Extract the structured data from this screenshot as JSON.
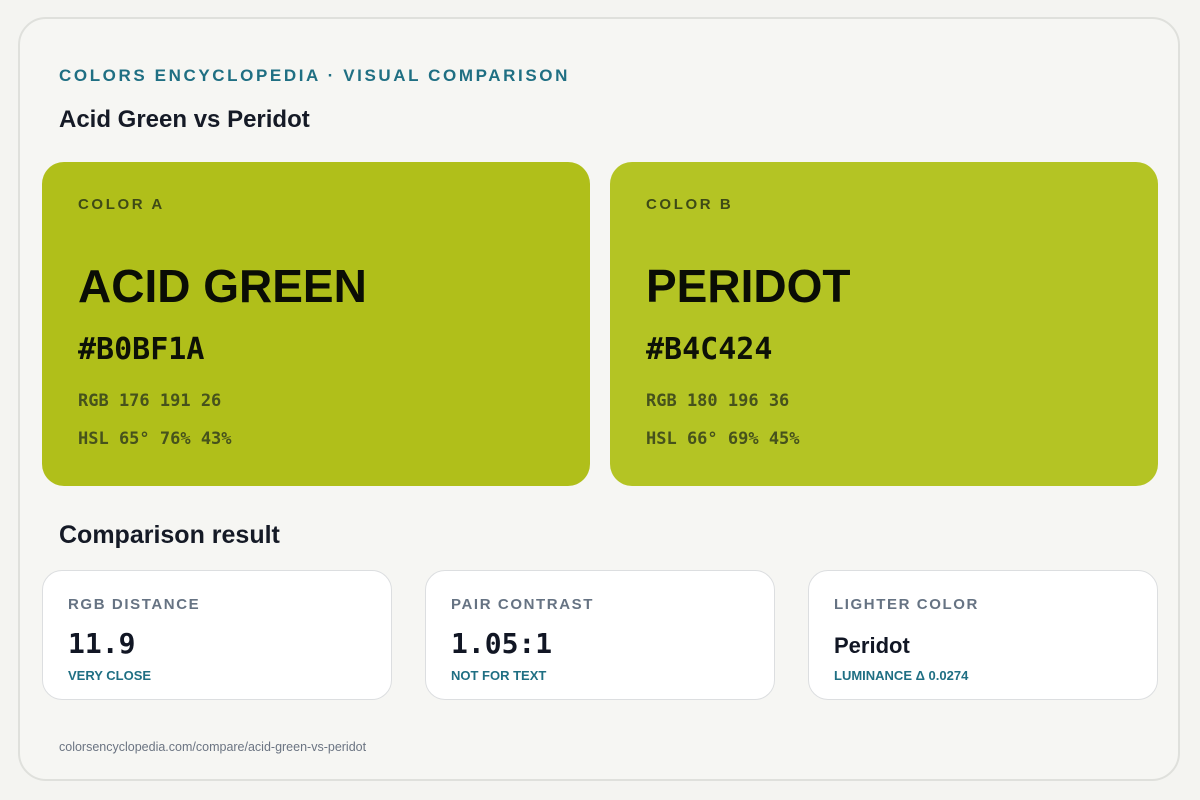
{
  "header": {
    "kicker": "COLORS ENCYCLOPEDIA · VISUAL COMPARISON",
    "title": "Acid Green vs Peridot"
  },
  "color_a": {
    "label": "COLOR A",
    "name": "ACID GREEN",
    "hex": "#B0BF1A",
    "rgb": "RGB 176 191 26",
    "hsl": "HSL 65° 76% 43%",
    "swatch_color": "#b0bf1a"
  },
  "color_b": {
    "label": "COLOR B",
    "name": "PERIDOT",
    "hex": "#B4C424",
    "rgb": "RGB 180 196 36",
    "hsl": "HSL 66° 69% 45%",
    "swatch_color": "#b4c424"
  },
  "comparison": {
    "title": "Comparison result",
    "rgb_distance": {
      "label": "RGB DISTANCE",
      "value": "11.9",
      "note": "VERY CLOSE"
    },
    "pair_contrast": {
      "label": "PAIR CONTRAST",
      "value": "1.05:1",
      "note": "NOT FOR TEXT"
    },
    "lighter_color": {
      "label": "LIGHTER COLOR",
      "value": "Peridot",
      "note": "LUMINANCE Δ 0.0274"
    }
  },
  "footer": {
    "url": "colorsencyclopedia.com/compare/acid-green-vs-peridot"
  },
  "colors": {
    "accent": "#1f6f83",
    "background": "#f6f6f3",
    "text": "#151a26"
  }
}
